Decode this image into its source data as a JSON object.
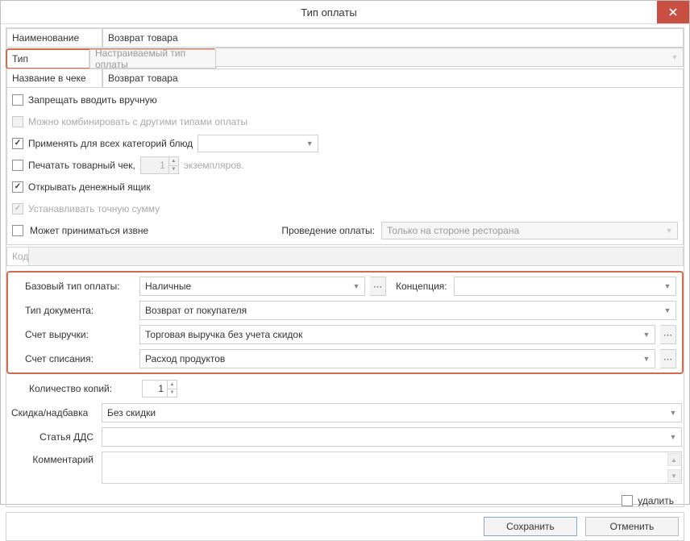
{
  "window": {
    "title": "Тип оплаты"
  },
  "fields": {
    "name_label": "Наименование",
    "name_value": "Возврат товара",
    "type_label": "Тип",
    "type_value": "Настраиваемый тип оплаты",
    "receipt_name_label": "Название в чеке",
    "receipt_name_value": "Возврат товара"
  },
  "checks": {
    "deny_manual": "Запрещать вводить вручную",
    "combine_other": "Можно комбинировать с другими типами оплаты",
    "apply_all_cat": "Применять для всех категорий блюд",
    "print_slip": "Печатать товарный чек,",
    "print_slip_copies": "1",
    "print_slip_suffix": "экземпляров.",
    "open_drawer": "Открывать денежный ящик",
    "set_exact_sum": "Устанавливать точную сумму",
    "accept_external": "Может приниматься извне",
    "processing_label": "Проведение оплаты:",
    "processing_value": "Только на стороне ресторана",
    "code_label": "Код"
  },
  "hl": {
    "base_type_label": "Базовый тип оплаты:",
    "base_type_value": "Наличные",
    "concept_label": "Концепция:",
    "concept_value": "",
    "doc_type_label": "Тип документа:",
    "doc_type_value": "Возврат от покупателя",
    "rev_acc_label": "Счет выручки:",
    "rev_acc_value": "Торговая выручка без учета скидок",
    "wo_acc_label": "Счет списания:",
    "wo_acc_value": "Расход продуктов"
  },
  "below": {
    "copies_label": "Количество копий:",
    "copies_value": "1",
    "discount_label": "Скидка/надбавка",
    "discount_value": "Без скидки",
    "dds_label": "Статья ДДС",
    "dds_value": "",
    "comment_label": "Комментарий",
    "delete_label": "удалить"
  },
  "buttons": {
    "save": "Сохранить",
    "cancel": "Отменить"
  }
}
